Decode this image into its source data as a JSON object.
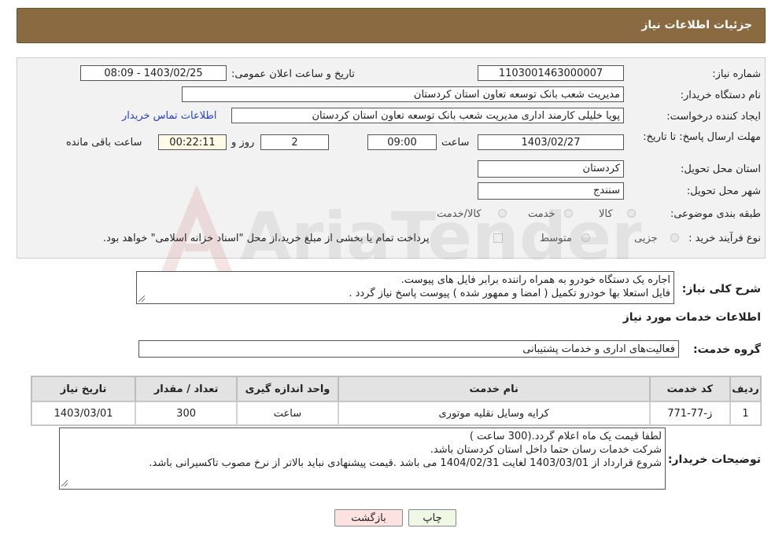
{
  "header": {
    "title": "جزئیات اطلاعات نیاز"
  },
  "form": {
    "need_number_label": "شماره نیاز:",
    "need_number": "1103001463000007",
    "announce_label": "تاریخ و ساعت اعلان عمومی:",
    "announce_value": "1403/02/25 - 08:09",
    "buyer_org_label": "نام دستگاه خریدار:",
    "buyer_org": "مدیریت شعب بانک توسعه تعاون استان کردستان",
    "creator_label": "ایجاد کننده درخواست:",
    "creator": "پویا خلیلی کارمند اداری مدیریت شعب بانک توسعه تعاون استان کردستان",
    "contact_link": "اطلاعات تماس خریدار",
    "deadline_label": "مهلت ارسال پاسخ: تا تاریخ:",
    "deadline_date": "1403/02/27",
    "time_label": "ساعت",
    "deadline_time": "09:00",
    "days_value": "2",
    "days_label": "روز و",
    "remaining_value": "00:22:11",
    "remaining_label": "ساعت باقی مانده",
    "province_label": "استان محل تحویل:",
    "province": "کردستان",
    "city_label": "شهر محل تحویل:",
    "city": "سنندج",
    "category_label": "طبقه بندی موضوعی:",
    "category_options": [
      "کالا",
      "خدمت",
      "کالا/خدمت"
    ],
    "process_label": "نوع فرآیند خرید :",
    "process_options": [
      "جزیی",
      "متوسط"
    ],
    "payment_note": "پرداخت تمام یا بخشی از مبلغ خرید،از محل \"اسناد خزانه اسلامی\" خواهد بود."
  },
  "description": {
    "label": "شرح کلی نیاز:",
    "text": "اجاره یک دستگاه خودرو به همراه راننده برابر فایل های پیوست.\nفایل استعلا بها خودرو تکمیل ( امضا و ممهور شده ) پیوست پاسخ نیاز گردد ."
  },
  "services": {
    "section_title": "اطلاعات خدمات مورد نیاز",
    "group_label": "گروه خدمت:",
    "group_value": "فعالیت‌های اداری و خدمات پشتیبانی",
    "columns": [
      "ردیف",
      "کد خدمت",
      "نام خدمت",
      "واحد اندازه گیری",
      "تعداد / مقدار",
      "تاریخ نیاز"
    ],
    "rows": [
      [
        "1",
        "ز-77-771",
        "کرایه وسایل نقلیه موتوری",
        "ساعت",
        "300",
        "1403/03/01"
      ]
    ]
  },
  "buyer_notes": {
    "label": "توضیحات خریدار:",
    "text": "لطفا قیمت یک ماه اعلام گردد.(300 ساعت )\nشرکت خدمات رسان حتما داخل استان کردستان باشد.\nشروع قرارداد از 1403/03/01 لغایت 1404/02/31 می باشد .قیمت پیشنهادی نباید بالاتر از نرخ مصوب تاکسیرانی باشد."
  },
  "buttons": {
    "print": "چاپ",
    "back": "بازگشت"
  },
  "watermark": {
    "text": "AriaTender.net"
  },
  "colors": {
    "header": "#8a6a41",
    "link": "#2440d6",
    "back_button": "#fde2e2",
    "print_button": "#eef8e4"
  }
}
